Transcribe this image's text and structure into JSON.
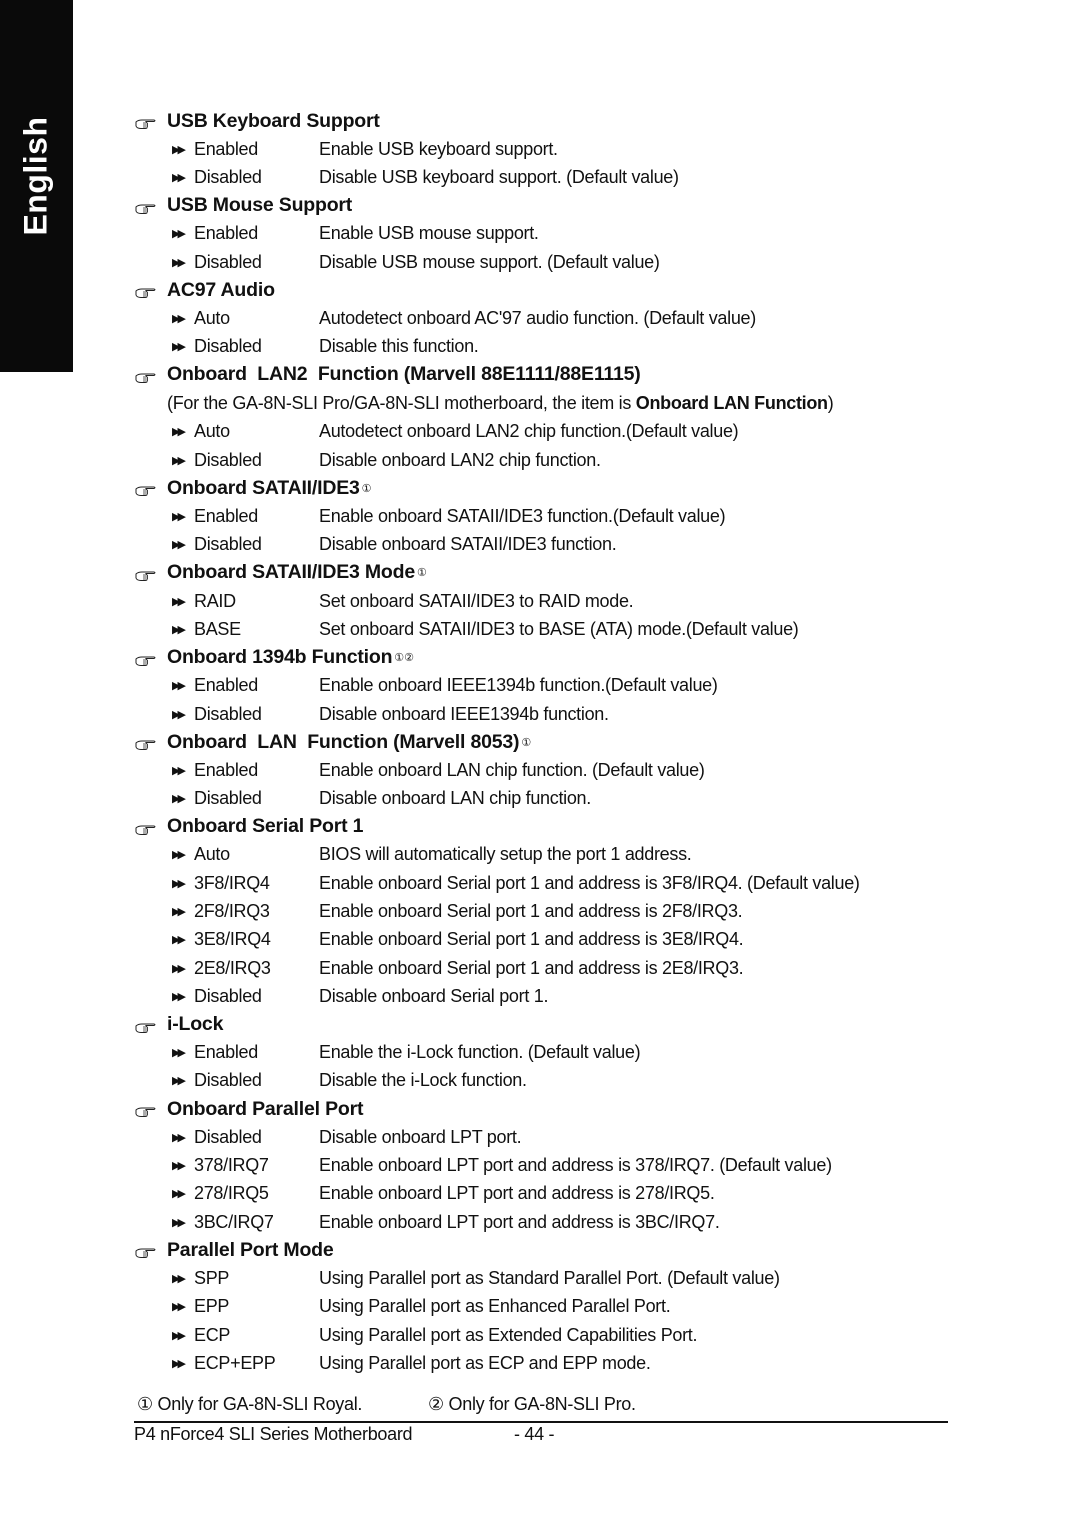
{
  "side_tab": {
    "label": "English"
  },
  "sections": [
    {
      "title": "USB Keyboard Support",
      "marks": "",
      "options": [
        {
          "key": "Enabled",
          "desc": "Enable USB keyboard support."
        },
        {
          "key": "Disabled",
          "desc": "Disable USB keyboard support. (Default value)"
        }
      ]
    },
    {
      "title": "USB Mouse Support",
      "marks": "",
      "options": [
        {
          "key": "Enabled",
          "desc": "Enable USB mouse support."
        },
        {
          "key": "Disabled",
          "desc": "Disable USB mouse support. (Default value)"
        }
      ]
    },
    {
      "title": "AC97 Audio",
      "marks": "",
      "options": [
        {
          "key": "Auto",
          "desc": "Autodetect onboard AC'97 audio function. (Default value)"
        },
        {
          "key": "Disabled",
          "desc": "Disable this function."
        }
      ]
    },
    {
      "title": "Onboard  LAN2  Function (Marvell 88E1111/88E1115)",
      "marks": "",
      "note": {
        "prefix": "(For the GA-8N-SLI Pro/GA-8N-SLI motherboard, the item is ",
        "bold": "Onboard LAN Function",
        "suffix": ")"
      },
      "options": [
        {
          "key": "Auto",
          "desc": "Autodetect onboard LAN2 chip function.(Default value)"
        },
        {
          "key": "Disabled",
          "desc": "Disable onboard LAN2 chip function."
        }
      ]
    },
    {
      "title": "Onboard SATAII/IDE3",
      "marks": "①",
      "options": [
        {
          "key": "Enabled",
          "desc": "Enable onboard SATAII/IDE3 function.(Default value)"
        },
        {
          "key": "Disabled",
          "desc": "Disable onboard SATAII/IDE3 function."
        }
      ]
    },
    {
      "title": "Onboard SATAII/IDE3 Mode",
      "marks": "①",
      "options": [
        {
          "key": "RAID",
          "desc": "Set onboard SATAII/IDE3 to RAID mode."
        },
        {
          "key": "BASE",
          "desc": "Set onboard SATAII/IDE3 to BASE (ATA) mode.(Default value)"
        }
      ]
    },
    {
      "title": "Onboard 1394b Function",
      "marks": "①②",
      "options": [
        {
          "key": "Enabled",
          "desc": "Enable onboard IEEE1394b function.(Default value)"
        },
        {
          "key": "Disabled",
          "desc": "Disable onboard IEEE1394b function."
        }
      ]
    },
    {
      "title": "Onboard  LAN  Function (Marvell 8053)",
      "marks": "①",
      "options": [
        {
          "key": "Enabled",
          "desc": "Enable onboard LAN chip function. (Default value)"
        },
        {
          "key": "Disabled",
          "desc": "Disable onboard LAN chip function."
        }
      ]
    },
    {
      "title": "Onboard Serial Port 1",
      "marks": "",
      "options": [
        {
          "key": "Auto",
          "desc": "BIOS will automatically setup the port 1 address."
        },
        {
          "key": "3F8/IRQ4",
          "desc": "Enable onboard Serial port 1 and address is 3F8/IRQ4. (Default value)"
        },
        {
          "key": "2F8/IRQ3",
          "desc": "Enable onboard Serial port 1 and address is 2F8/IRQ3."
        },
        {
          "key": "3E8/IRQ4",
          "desc": "Enable onboard Serial port 1 and address is 3E8/IRQ4."
        },
        {
          "key": "2E8/IRQ3",
          "desc": "Enable onboard Serial port 1 and address is 2E8/IRQ3."
        },
        {
          "key": "Disabled",
          "desc": "Disable onboard Serial port 1."
        }
      ]
    },
    {
      "title": "i-Lock",
      "marks": "",
      "options": [
        {
          "key": "Enabled",
          "desc": "Enable the i-Lock function. (Default value)"
        },
        {
          "key": "Disabled",
          "desc": "Disable the i-Lock function."
        }
      ]
    },
    {
      "title": "Onboard Parallel Port",
      "marks": "",
      "options": [
        {
          "key": "Disabled",
          "desc": "Disable onboard LPT port."
        },
        {
          "key": "378/IRQ7",
          "desc": "Enable onboard LPT port and address is 378/IRQ7. (Default value)"
        },
        {
          "key": "278/IRQ5",
          "desc": "Enable onboard LPT port and address is 278/IRQ5."
        },
        {
          "key": "3BC/IRQ7",
          "desc": "Enable onboard LPT port and address is 3BC/IRQ7."
        }
      ]
    },
    {
      "title": "Parallel Port Mode",
      "marks": "",
      "options": [
        {
          "key": "SPP",
          "desc": "Using Parallel port as Standard Parallel Port. (Default value)"
        },
        {
          "key": "EPP",
          "desc": "Using Parallel port as Enhanced Parallel Port."
        },
        {
          "key": "ECP",
          "desc": "Using Parallel port as Extended Capabilities Port."
        },
        {
          "key": "ECP+EPP",
          "desc": "Using Parallel port as ECP and EPP mode."
        }
      ]
    }
  ],
  "footnotes": {
    "note1": "① Only for GA-8N-SLI Royal.",
    "note2": "② Only for GA-8N-SLI Pro."
  },
  "footer": {
    "title": "P4 nForce4 SLI Series Motherboard",
    "page": "- 44 -"
  },
  "icons": {
    "heading_bullet": "pointing-hand-icon",
    "option_bullet": "fast-forward-icon"
  }
}
